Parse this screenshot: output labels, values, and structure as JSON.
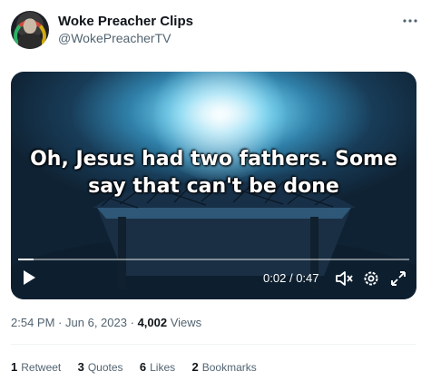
{
  "author": {
    "display_name": "Woke Preacher Clips",
    "handle": "@WokePreacherTV"
  },
  "more_icon": "more-horizontal-icon",
  "video": {
    "caption": "Oh, Jesus had two fathers. Some say that can't be done",
    "current_time": "0:02",
    "separator": "/",
    "duration": "0:47",
    "progress_fraction": 0.04,
    "icons": [
      "play-icon",
      "mute-icon",
      "settings-icon",
      "fullscreen-icon"
    ]
  },
  "meta": {
    "time": "2:54 PM",
    "dot1": "·",
    "date": "Jun 6, 2023",
    "dot2": "·",
    "views_count": "4,002",
    "views_label": "Views"
  },
  "stats": {
    "retweets": {
      "count": "1",
      "label": "Retweet"
    },
    "quotes": {
      "count": "3",
      "label": "Quotes"
    },
    "likes": {
      "count": "6",
      "label": "Likes"
    },
    "bookmarks": {
      "count": "2",
      "label": "Bookmarks"
    }
  },
  "colors": {
    "text_primary": "#0f1419",
    "text_secondary": "#536471",
    "divider": "#eff3f4"
  }
}
